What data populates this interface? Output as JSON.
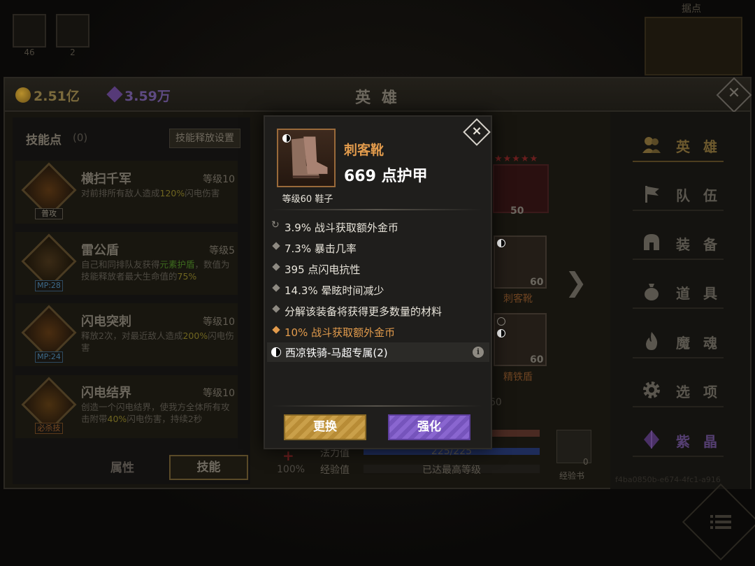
{
  "top": {
    "slot1_count": "46",
    "slot2_count": "2",
    "map_label": "据点"
  },
  "header": {
    "gold": "2.51亿",
    "gems": "3.59万",
    "title": "英 雄"
  },
  "skills_panel": {
    "points_label": "技能点",
    "points_count": "(0)",
    "setting_button": "技能释放设置",
    "skills": [
      {
        "name": "横扫千军",
        "level": "等级10",
        "tag": "普攻",
        "desc_a": "对前排所有敌人造成",
        "desc_hl": "120%",
        "desc_b": "闪电伤害"
      },
      {
        "name": "雷公盾",
        "level": "等级5",
        "tag": "MP:28",
        "desc_a": "自己和同排队友获得",
        "desc_hl": "元素护盾",
        "desc_b": "，数值为技能释放者最大生命值的",
        "desc_hl2": "75%"
      },
      {
        "name": "闪电突刺",
        "level": "等级10",
        "tag": "MP:24",
        "desc_a": "释放2次，对最近敌人造成",
        "desc_hl": "200%",
        "desc_b": "闪电伤害"
      },
      {
        "name": "闪电结界",
        "level": "等级10",
        "tag": "必杀技",
        "desc_a": "创造一个闪电结界，使我方全体所有攻击附带",
        "desc_hl": "40%",
        "desc_b": "闪电伤害，持续2秒"
      }
    ],
    "tabs": {
      "attr": "属性",
      "skill": "技能"
    }
  },
  "hero": {
    "hero_level": "50",
    "equip": [
      {
        "level": "60",
        "name": "刺客靴"
      },
      {
        "level": "60",
        "name": "精铁盾"
      }
    ],
    "level_partial": "60",
    "mana_label": "法力值",
    "mana_value": "225/225",
    "exp_label": "经验值",
    "exp_value": "已达最高等级",
    "percent": "100%",
    "book_label": "经验书",
    "book_count": "0"
  },
  "sidebar": {
    "items": [
      {
        "label": "英 雄",
        "icon": "hero-icon"
      },
      {
        "label": "队 伍",
        "icon": "flag-icon"
      },
      {
        "label": "装 备",
        "icon": "helmet-icon"
      },
      {
        "label": "道 具",
        "icon": "bag-icon"
      },
      {
        "label": "魔 魂",
        "icon": "flame-icon"
      },
      {
        "label": "选 项",
        "icon": "gear-icon"
      },
      {
        "label": "紫 晶",
        "icon": "crystal-icon"
      }
    ],
    "uuid": "f4ba0850b-e674-4fc1-a916"
  },
  "popup": {
    "item_name": "刺客靴",
    "armor": "669 点护甲",
    "subtitle": "等级60 鞋子",
    "stats": [
      {
        "text": "3.9% 战斗获取额外金币",
        "type": "refresh"
      },
      {
        "text": "7.3% 暴击几率",
        "type": "normal"
      },
      {
        "text": "395 点闪电抗性",
        "type": "normal"
      },
      {
        "text": "14.3% 晕眩时间减少",
        "type": "normal"
      },
      {
        "text": "分解该装备将获得更多数量的材料",
        "type": "normal"
      },
      {
        "text": "10% 战斗获取额外金币",
        "type": "orange"
      }
    ],
    "set_name": "西凉铁骑-马超专属(2)",
    "replace_button": "更换",
    "upgrade_button": "强化"
  },
  "colors": {
    "accent_orange": "#e29b4c",
    "gold_button": "#caa04a",
    "purple_button": "#8a66d0"
  }
}
